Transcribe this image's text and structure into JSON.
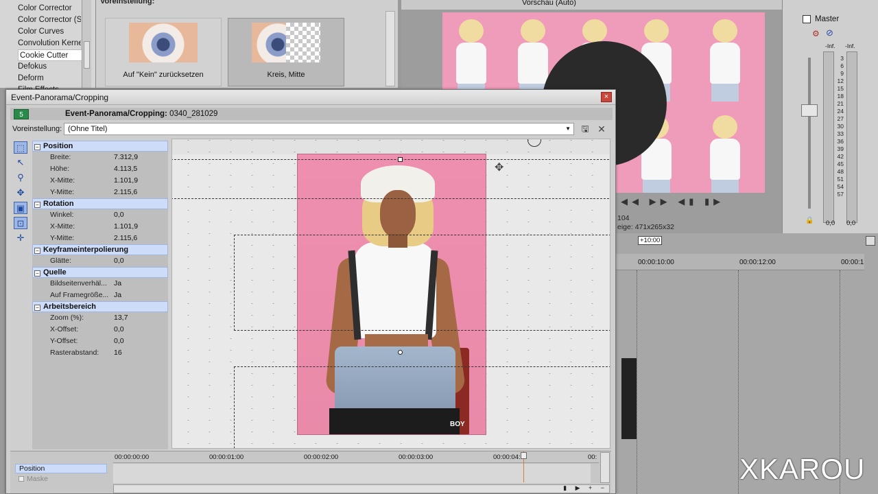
{
  "fx_list": [
    "Color Corrector",
    "Color Corrector (S",
    "Color Curves",
    "Convolution Kerne",
    "Cookie Cutter",
    "Defokus",
    "Deform",
    "Film Effects"
  ],
  "fx_selected_index": 4,
  "preset_panel": {
    "label": "Voreinstellung:",
    "cards": [
      "Auf \"Kein\" zurücksetzen",
      "Kreis, Mitte"
    ]
  },
  "preview": {
    "toolbar_label": "Vorschau (Auto)",
    "info_line1": "104",
    "info_line2_label": "eige:",
    "info_line2_value": "471x265x32"
  },
  "master": {
    "title": "Master",
    "scale": [
      "3",
      "6",
      "9",
      "12",
      "15",
      "18",
      "21",
      "24",
      "27",
      "30",
      "33",
      "36",
      "39",
      "42",
      "45",
      "48",
      "51",
      "54",
      "57"
    ],
    "left_top": "-Inf.",
    "right_top": "-Inf.",
    "left_bottom": "0,0",
    "right_bottom": "0,0"
  },
  "timeline": {
    "position": "+10:00",
    "marks": [
      "00:00:10:00",
      "00:00:12:00",
      "00:00:1"
    ]
  },
  "watermark": "XKAROU",
  "dialog": {
    "title": "Event-Panorama/Cropping",
    "close": "×",
    "badge": "5",
    "header_title": "Event-Panorama/Cropping:",
    "header_clip": "0340_281029",
    "preset_label": "Voreinstellung:",
    "preset_value": "(Ohne Titel)",
    "sections": [
      {
        "title": "Position",
        "rows": [
          [
            "Breite:",
            "7.312,9"
          ],
          [
            "Höhe:",
            "4.113,5"
          ],
          [
            "X-Mitte:",
            "1.101,9"
          ],
          [
            "Y-Mitte:",
            "2.115,6"
          ]
        ]
      },
      {
        "title": "Rotation",
        "rows": [
          [
            "Winkel:",
            "0,0"
          ],
          [
            "X-Mitte:",
            "1.101,9"
          ],
          [
            "Y-Mitte:",
            "2.115,6"
          ]
        ]
      },
      {
        "title": "Keyframeinterpolierung",
        "rows": [
          [
            "Glätte:",
            "0,0"
          ]
        ]
      },
      {
        "title": "Quelle",
        "rows": [
          [
            "Bildseitenverhäl...",
            "Ja"
          ],
          [
            "Auf Framegröße...",
            "Ja"
          ]
        ]
      },
      {
        "title": "Arbeitsbereich",
        "rows": [
          [
            "Zoom (%):",
            "13,7"
          ],
          [
            "X-Offset:",
            "0,0"
          ],
          [
            "Y-Offset:",
            "0,0"
          ],
          [
            "Rasterabstand:",
            "16"
          ]
        ]
      }
    ],
    "photo_text": "BOY",
    "keyframes": {
      "track_label": "Position",
      "mask_label": "Maske",
      "ticks": [
        "00:00:00:00",
        "00:00:01:00",
        "00:00:02:00",
        "00:00:03:00",
        "00:00:04:",
        "00:"
      ]
    }
  }
}
